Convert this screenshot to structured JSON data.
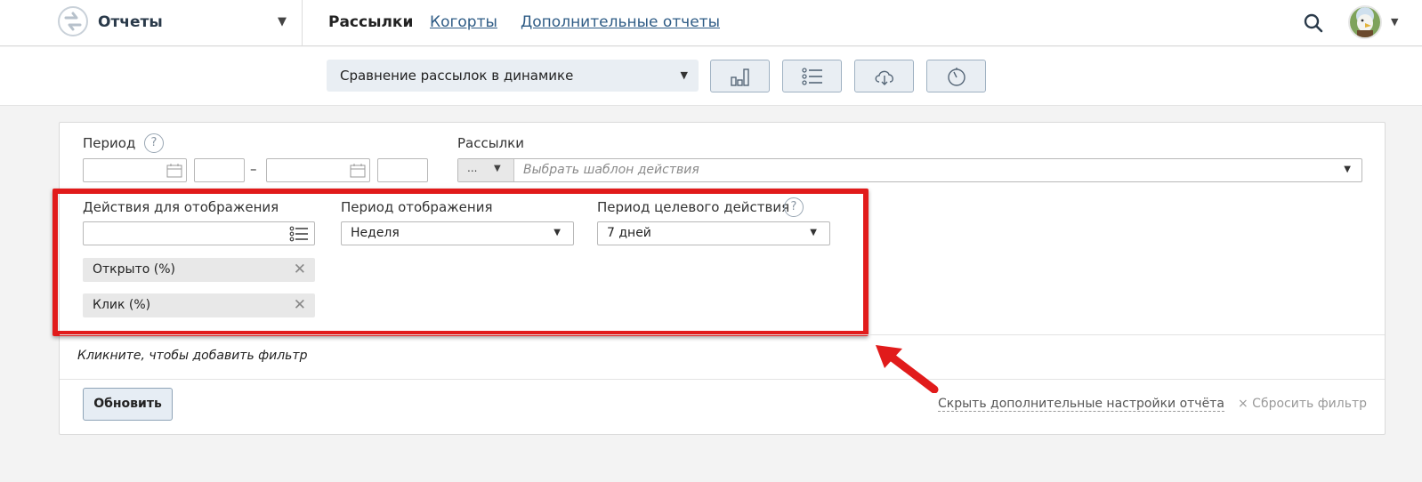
{
  "header": {
    "app_title": "Отчеты",
    "nav": {
      "active": "Рассылки",
      "links": [
        "Когорты",
        "Дополнительные отчеты"
      ]
    }
  },
  "toolbar": {
    "report_select": "Сравнение рассылок в динамике",
    "buttons": [
      "bar-chart-icon",
      "list-icon",
      "cloud-download-icon",
      "timer-icon"
    ]
  },
  "filters": {
    "period_label": "Период",
    "period_help": "?",
    "period_dash": "–",
    "mailings_label": "Рассылки",
    "mailings_dots": "...",
    "mailings_placeholder": "Выбрать шаблон действия",
    "actions_label": "Действия для отображения",
    "display_period_label": "Период отображения",
    "display_period_value": "Неделя",
    "target_period_label": "Период целевого действия",
    "target_period_help": "?",
    "target_period_value": "7 дней",
    "action_tags": [
      "Открыто (%)",
      "Клик (%)"
    ],
    "add_filter_hint": "Кликните, чтобы добавить фильтр"
  },
  "footer": {
    "refresh_button": "Обновить",
    "hide_settings_link": "Скрыть дополнительные настройки отчёта",
    "reset_filter_link": "× Сбросить фильтр"
  },
  "colors": {
    "highlight": "#e11b1b",
    "link": "#2f5c86",
    "button_bg": "#e9eef3"
  }
}
